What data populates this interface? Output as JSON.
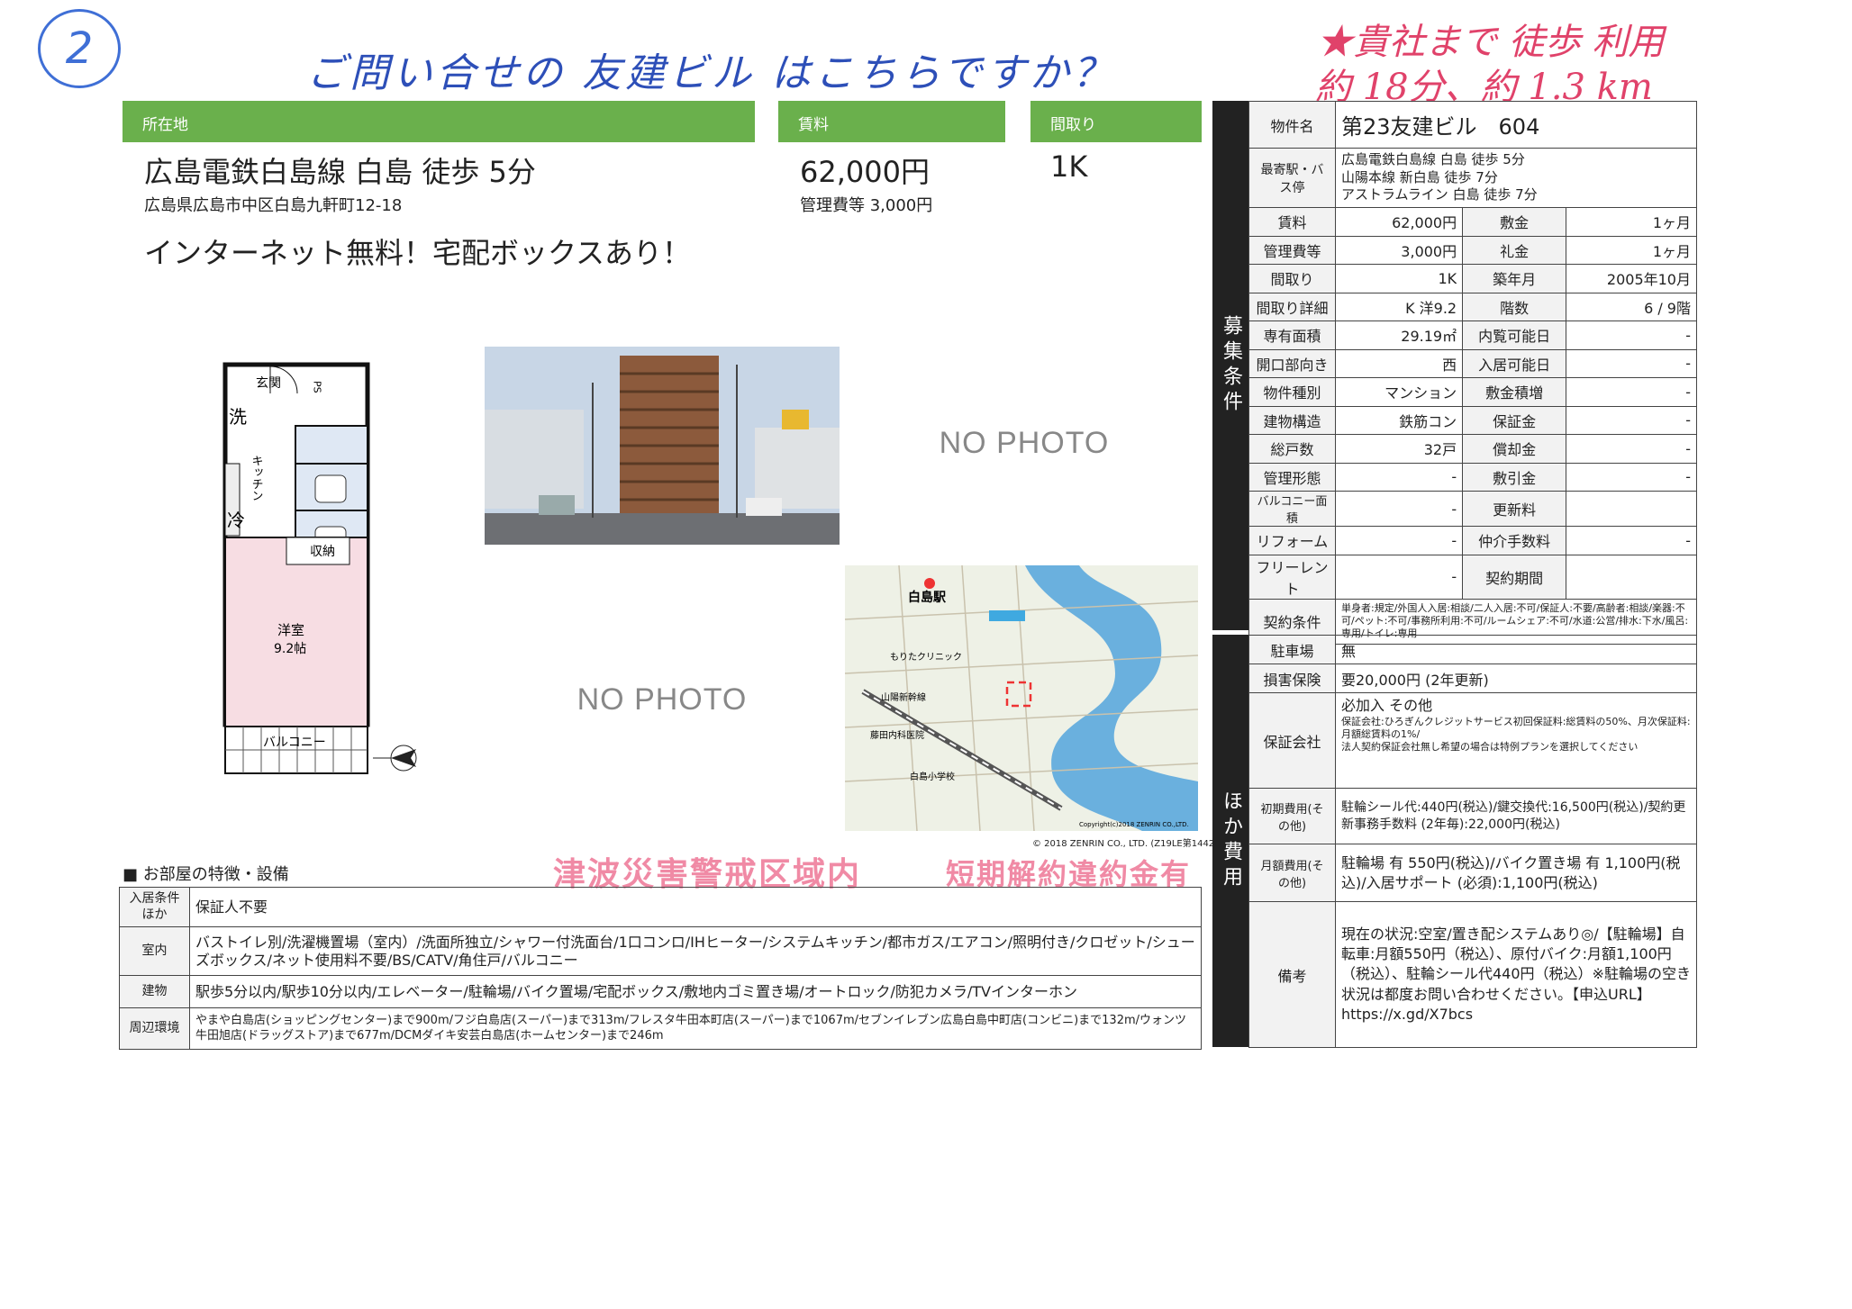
{
  "annotations": {
    "circle_number": "2",
    "handwritten_question": "ご問い合せの 友建ビル はこちらですか？",
    "walk_note_line1": "★貴社まで 徒歩 利用",
    "walk_note_line2": "約 18分、約 1.3 km"
  },
  "header": {
    "location_label": "所在地",
    "rent_label": "賃料",
    "layout_label": "間取り"
  },
  "summary": {
    "station": "広島電鉄白島線 白島 徒歩 5分",
    "address": "広島県広島市中区白島九軒町12-18",
    "rent": "62,000円",
    "fee": "管理費等 3,000円",
    "layout": "1K",
    "catchphrase": "インターネット無料！宅配ボックスあり！"
  },
  "floorplan": {
    "entrance": "玄関",
    "ps": "PS",
    "wash": "洗",
    "kitchen": "キッチン",
    "fridge": "冷",
    "storage": "収納",
    "room": "洋室",
    "room_size": "9.2帖",
    "balcony": "バルコニー"
  },
  "photos": {
    "no_photo_1": "NO PHOTO",
    "no_photo_2": "NO PHOTO"
  },
  "map": {
    "station": "白島駅",
    "clinic": "もりたクリニック",
    "school": "白島小学校",
    "hospital": "藤田内科医院",
    "line": "山陽新幹線",
    "copyright_1": "Copyright(c)2018 ZENRIN CO.,LTD.",
    "copyright_2": "© 2018 ZENRIN CO., LTD. (Z19LE第1442号)"
  },
  "side_labels": {
    "recruit": "募集条件",
    "other_cost": "ほか費用"
  },
  "conditions": {
    "name_label": "物件名",
    "name_value": "第23友建ビル　604",
    "station_label": "最寄駅・バス停",
    "station_lines": [
      "広島電鉄白島線 白島 徒歩 5分",
      "山陽本線 新白島 徒歩 7分",
      "アストラムライン 白島 徒歩 7分"
    ],
    "rows": [
      {
        "l1": "賃料",
        "v1": "62,000円",
        "l2": "敷金",
        "v2": "1ヶ月"
      },
      {
        "l1": "管理費等",
        "v1": "3,000円",
        "l2": "礼金",
        "v2": "1ヶ月"
      },
      {
        "l1": "間取り",
        "v1": "1K",
        "l2": "築年月",
        "v2": "2005年10月"
      },
      {
        "l1": "間取り詳細",
        "v1": "K 洋9.2",
        "l2": "階数",
        "v2": "6 / 9階"
      },
      {
        "l1": "専有面積",
        "v1": "29.19㎡",
        "l2": "内覧可能日",
        "v2": "-"
      },
      {
        "l1": "開口部向き",
        "v1": "西",
        "l2": "入居可能日",
        "v2": "-"
      },
      {
        "l1": "物件種別",
        "v1": "マンション",
        "l2": "敷金積増",
        "v2": "-"
      },
      {
        "l1": "建物構造",
        "v1": "鉄筋コン",
        "l2": "保証金",
        "v2": "-"
      },
      {
        "l1": "総戸数",
        "v1": "32戸",
        "l2": "償却金",
        "v2": "-"
      },
      {
        "l1": "管理形態",
        "v1": "-",
        "l2": "敷引金",
        "v2": "-"
      },
      {
        "l1": "バルコニー面積",
        "v1": "-",
        "l2": "更新料",
        "v2": ""
      },
      {
        "l1": "リフォーム",
        "v1": "-",
        "l2": "仲介手数料",
        "v2": "-"
      },
      {
        "l1": "フリーレント",
        "v1": "-",
        "l2": "契約期間",
        "v2": ""
      }
    ],
    "contract_label": "契約条件",
    "contract_value": "単身者:規定/外国人入居:相談/二人入居:不可/保証人:不要/高齢者:相談/楽器:不可/ペット:不可/事務所利用:不可/ルームシェア:不可/水道:公営/排水:下水/風呂:専用/トイレ:専用"
  },
  "costs": {
    "parking_label": "駐車場",
    "parking_value": "無",
    "insurance_label": "損害保険",
    "insurance_value": "要20,000円 (2年更新)",
    "guarantor_label": "保証会社",
    "guarantor_value_1": "必加入 その他",
    "guarantor_value_2": "保証会社:ひろぎんクレジットサービス初回保証料:総賃料の50%、月次保証料:月額総賃料の1%/",
    "guarantor_value_3": "法人契約保証会社無し希望の場合は特例プランを選択してください",
    "initial_label": "初期費用(その他)",
    "initial_value": "駐輪シール代:440円(税込)/鍵交換代:16,500円(税込)/契約更新事務手数料 (2年毎):22,000円(税込)",
    "monthly_label": "月額費用(その他)",
    "monthly_value": "駐輪場 有 550円(税込)/バイク置き場 有 1,100円(税込)/入居サポート (必須):1,100円(税込)",
    "remarks_label": "備考",
    "remarks_value": "現在の状況:空室/置き配システムあり◎/【駐輪場】自転車:月額550円（税込）、原付バイク:月額1,100円（税込）、駐輪シール代440円（税込）※駐輪場の空き状況は都度お問い合わせください。【申込URL】https://x.gd/X7bcs"
  },
  "stamps": {
    "tsunami": "津波災害警戒区域内",
    "penalty": "短期解約違約金有"
  },
  "features": {
    "title": "■ お部屋の特徴・設備",
    "rows": [
      {
        "label": "入居条件ほか",
        "value": "保証人不要"
      },
      {
        "label": "室内",
        "value": "バストイレ別/洗濯機置場（室内）/洗面所独立/シャワー付洗面台/1口コンロ/IHヒーター/システムキッチン/都市ガス/エアコン/照明付き/クロゼット/シューズボックス/ネット使用料不要/BS/CATV/角住戸/バルコニー"
      },
      {
        "label": "建物",
        "value": "駅歩5分以内/駅歩10分以内/エレベーター/駐輪場/バイク置場/宅配ボックス/敷地内ゴミ置き場/オートロック/防犯カメラ/TVインターホン"
      },
      {
        "label": "周辺環境",
        "value": "やまや白島店(ショッピングセンター)まで900m/フジ白島店(スーパー)まで313m/フレスタ牛田本町店(スーパー)まで1067m/セブンイレブン広島白島中町店(コンビニ)まで132m/ウォンツ牛田旭店(ドラッグストア)まで677m/DCMダイキ安芸白島店(ホームセンター)まで246m"
      }
    ]
  }
}
